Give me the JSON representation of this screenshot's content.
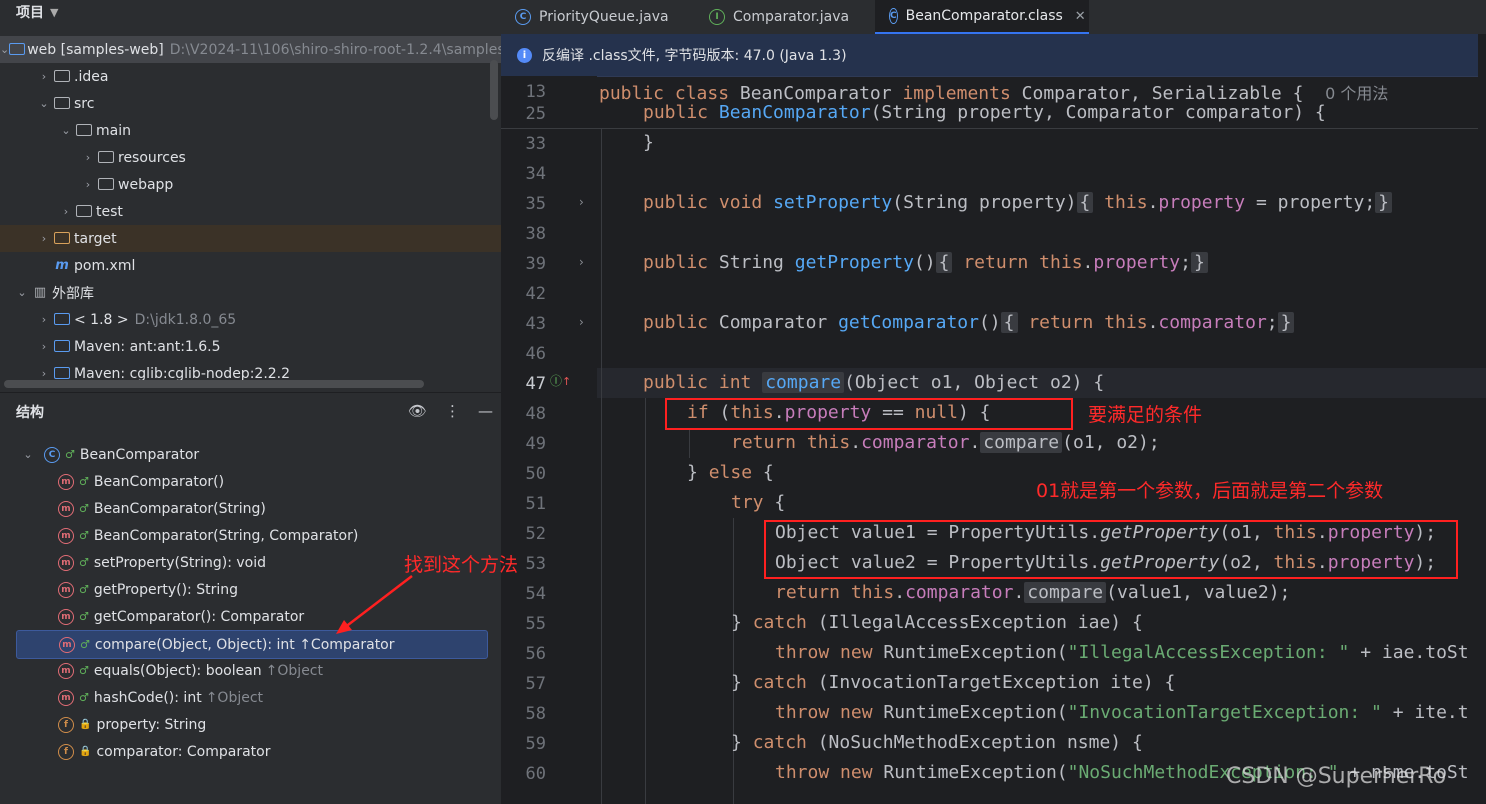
{
  "project_panel": {
    "title": "项目",
    "tree": [
      {
        "label": "web [samples-web]",
        "extra": "D:\\V2024-11\\106\\shiro-shiro-root-1.2.4\\samples",
        "level": 0,
        "expanded": true,
        "icon": "module-folder-icon"
      },
      {
        "label": ".idea",
        "level": 1,
        "expanded": false,
        "icon": "folder-icon"
      },
      {
        "label": "src",
        "level": 1,
        "expanded": true,
        "icon": "folder-icon"
      },
      {
        "label": "main",
        "level": 2,
        "expanded": true,
        "icon": "folder-icon"
      },
      {
        "label": "resources",
        "level": 3,
        "expanded": false,
        "icon": "resources-folder-icon"
      },
      {
        "label": "webapp",
        "level": 3,
        "expanded": false,
        "icon": "web-folder-icon"
      },
      {
        "label": "test",
        "level": 2,
        "expanded": false,
        "icon": "folder-icon"
      },
      {
        "label": "target",
        "level": 1,
        "expanded": false,
        "icon": "excluded-folder-icon"
      },
      {
        "label": "pom.xml",
        "level": 1,
        "icon": "maven-icon"
      },
      {
        "label": "外部库",
        "level": 0,
        "expanded": true,
        "icon": "library-icon"
      },
      {
        "label": "< 1.8 >",
        "extra": "D:\\jdk1.8.0_65",
        "level": 1,
        "expanded": false,
        "icon": "jdk-icon"
      },
      {
        "label": "Maven: ant:ant:1.6.5",
        "level": 1,
        "expanded": false,
        "icon": "jar-icon"
      },
      {
        "label": "Maven: cglib:cglib-nodep:2.2.2",
        "level": 1,
        "expanded": false,
        "icon": "jar-icon"
      }
    ]
  },
  "structure_panel": {
    "title": "结构",
    "root": "BeanComparator",
    "items": [
      {
        "label": "BeanComparator()",
        "kind": "m",
        "extra": ""
      },
      {
        "label": "BeanComparator(String)",
        "kind": "m",
        "extra": ""
      },
      {
        "label": "BeanComparator(String, Comparator)",
        "kind": "m",
        "extra": ""
      },
      {
        "label": "setProperty(String): void",
        "kind": "m",
        "extra": ""
      },
      {
        "label": "getProperty(): String",
        "kind": "m",
        "extra": ""
      },
      {
        "label": "getComparator(): Comparator",
        "kind": "m",
        "extra": ""
      },
      {
        "label": "compare(Object, Object): int ↑Comparator",
        "kind": "m",
        "extra": "",
        "selected": true
      },
      {
        "label": "equals(Object): boolean",
        "kind": "m",
        "extra": "↑Object"
      },
      {
        "label": "hashCode(): int",
        "kind": "m",
        "extra": "↑Object"
      },
      {
        "label": "property: String",
        "kind": "f",
        "extra": ""
      },
      {
        "label": "comparator: Comparator",
        "kind": "f",
        "extra": ""
      }
    ]
  },
  "tabs": [
    {
      "label": "PriorityQueue.java",
      "icon": "class-icon",
      "active": false
    },
    {
      "label": "Comparator.java",
      "icon": "interface-icon",
      "active": false
    },
    {
      "label": "BeanComparator.class",
      "icon": "class-icon",
      "active": true
    }
  ],
  "banner": {
    "text": "反编译 .class文件, 字节码版本: 47.0 (Java 1.3)"
  },
  "line_numbers": [
    "13",
    "25",
    "33",
    "34",
    "35",
    "38",
    "39",
    "42",
    "43",
    "46",
    "47",
    "48",
    "49",
    "50",
    "51",
    "52",
    "53",
    "54",
    "55",
    "56",
    "57",
    "58",
    "59",
    "60"
  ],
  "inlay_usage": "0 个用法",
  "annotations": {
    "condition": "要满足的条件",
    "params": "01就是第一个参数，后面就是第二个参数",
    "find_method": "找到这个方法"
  },
  "watermark": "CSDN @SuperherRo",
  "colors": {
    "accent": "#3574f0",
    "annotation": "#ff2020",
    "keyword": "#cf8e6d",
    "method": "#56a8f5",
    "field": "#c77dbb",
    "string": "#6aab73"
  }
}
